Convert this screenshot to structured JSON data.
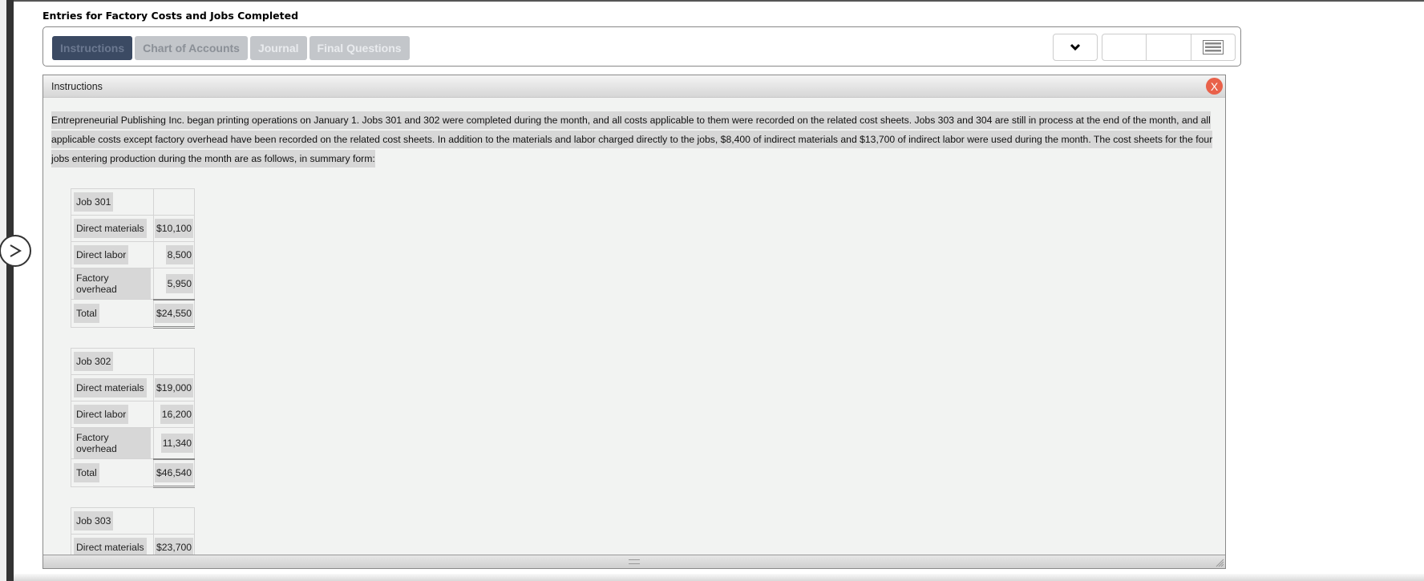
{
  "page": {
    "title": "Entries for Factory Costs and Jobs Completed"
  },
  "tabs": [
    {
      "label": "Instructions",
      "active": true
    },
    {
      "label": "Chart of Accounts",
      "active": false
    },
    {
      "label": "Journal",
      "active": false
    },
    {
      "label": "Final Questions",
      "active": false
    }
  ],
  "toolbar": {
    "dropdown_icon": "chevron-down-icon",
    "menu_icon": "list-icon"
  },
  "panel": {
    "title": "Instructions",
    "close_label": "X",
    "paragraph": "Entrepreneurial Publishing Inc. began printing operations on January 1. Jobs 301 and 302 were completed during the month, and all costs applicable to them were recorded on the related cost sheets. Jobs 303 and 304 are still in process at the end of the month, and all applicable costs except factory overhead have been recorded on the related cost sheets. In addition to the materials and labor charged directly to the jobs, $8,400 of indirect materials and $13,700 of indirect labor were used during the month. The cost sheets for the four jobs entering production during the month are as follows, in summary form:",
    "jobs": [
      {
        "name": "Job 301",
        "rows": [
          {
            "label": "Direct materials",
            "value": "$10,100"
          },
          {
            "label": "Direct labor",
            "value": "8,500"
          },
          {
            "label": "Factory overhead",
            "value": "5,950"
          },
          {
            "label": "Total",
            "value": "$24,550"
          }
        ]
      },
      {
        "name": "Job 302",
        "rows": [
          {
            "label": "Direct materials",
            "value": "$19,000"
          },
          {
            "label": "Direct labor",
            "value": "16,200"
          },
          {
            "label": "Factory overhead",
            "value": "11,340"
          },
          {
            "label": "Total",
            "value": "$46,540"
          }
        ]
      },
      {
        "name": "Job 303",
        "rows": [
          {
            "label": "Direct materials",
            "value": "$23,700"
          }
        ]
      }
    ]
  }
}
